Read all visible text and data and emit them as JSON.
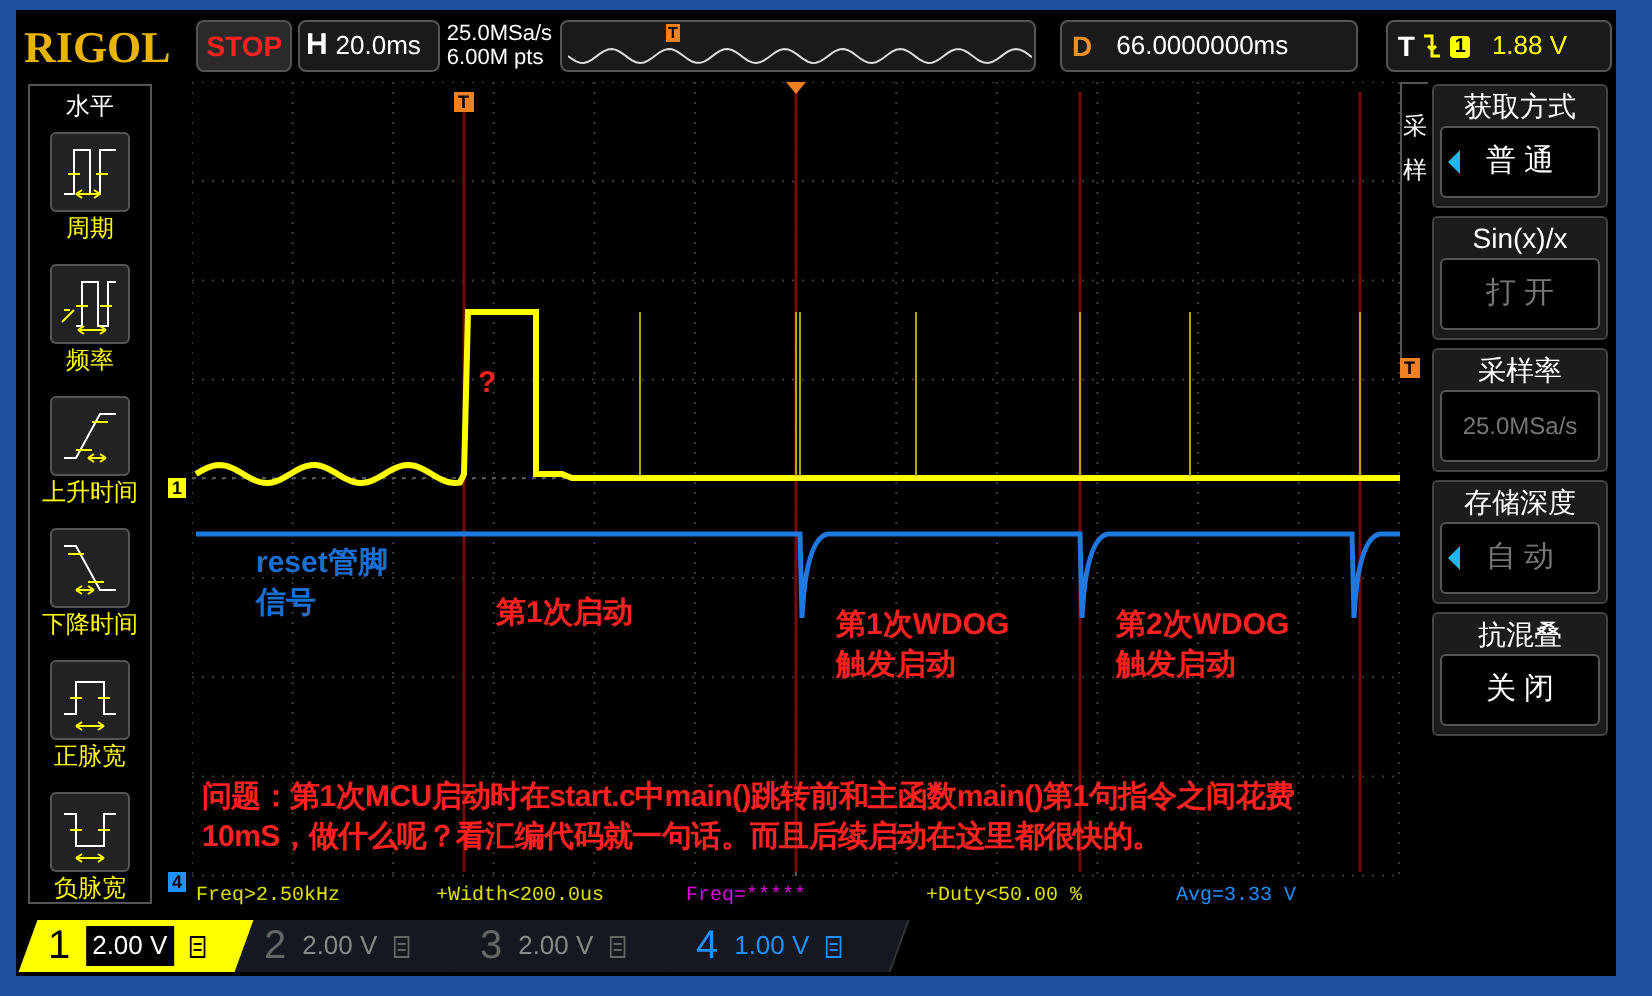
{
  "top_bar": {
    "logo": "RIGOL",
    "run_state": "STOP",
    "horizontal": {
      "label": "H",
      "value": "20.0ms"
    },
    "sample_rate": "25.0MSa/s",
    "memory_depth": "6.00M pts",
    "overview_trigger": "T",
    "delay": {
      "label": "D",
      "value": "66.0000000ms"
    },
    "trigger": {
      "label": "T",
      "source": "1",
      "level": "1.88 V"
    }
  },
  "left_menu": {
    "title": "水平",
    "items": [
      {
        "label": "周期",
        "kind": "period"
      },
      {
        "label": "频率",
        "kind": "frequency"
      },
      {
        "label": "上升时间",
        "kind": "rise"
      },
      {
        "label": "下降时间",
        "kind": "fall"
      },
      {
        "label": "正脉宽",
        "kind": "positive_width"
      },
      {
        "label": "负脉宽",
        "kind": "negative_width"
      }
    ]
  },
  "display": {
    "channel_markers": [
      {
        "label": "1",
        "color": "#ffff00"
      },
      {
        "label": "4",
        "color": "#1e90ff"
      }
    ],
    "trigger_marker": "T",
    "right_trigger_marker": "T",
    "annotations": [
      {
        "text": "?",
        "color": "#ff2020"
      },
      {
        "text": "reset管脚",
        "color": "#1a6fd0"
      },
      {
        "text": "信号",
        "color": "#1a6fd0"
      },
      {
        "text": "第1次启动",
        "color": "#ff2020"
      },
      {
        "text": "第1次WDOG",
        "color": "#ff2020"
      },
      {
        "text": "触发启动",
        "color": "#ff2020"
      },
      {
        "text": "第2次WDOG",
        "color": "#ff2020"
      },
      {
        "text": "触发启动",
        "color": "#ff2020"
      },
      {
        "text": "问题：第1次MCU启动时在start.c中main()跳转前和主函数main()第1句指令之间花费10mS，做什么呢？看汇编代码就一句话。而且后续启动在这里都很快的。",
        "color": "#ff2020"
      }
    ]
  },
  "right_menu": {
    "tab": [
      "采",
      "样"
    ],
    "items": [
      {
        "title": "获取方式",
        "value": "普 通",
        "enabled": true,
        "arrow": true
      },
      {
        "title": "Sin(x)/x",
        "value": "打 开",
        "enabled": false,
        "arrow": false
      },
      {
        "title": "采样率",
        "value": "25.0MSa/s",
        "enabled": false,
        "arrow": false
      },
      {
        "title": "存储深度",
        "value": "自 动",
        "enabled": false,
        "arrow": true
      },
      {
        "title": "抗混叠",
        "value": "关 闭",
        "enabled": true,
        "arrow": false
      }
    ]
  },
  "measurements": [
    {
      "text": "Freq>2.50kHz",
      "color": "#e0e000"
    },
    {
      "text": "+Width<200.0us",
      "color": "#e0e000"
    },
    {
      "text": "Freq=*****",
      "color": "#e000e0"
    },
    {
      "text": "+Duty<50.00 %",
      "color": "#e0e000"
    },
    {
      "text": "Avg=3.33 V",
      "color": "#1e90ff"
    }
  ],
  "channels": [
    {
      "number": "1",
      "scale": "2.00 V",
      "on": true,
      "selected": true
    },
    {
      "number": "2",
      "scale": "2.00 V",
      "on": false,
      "selected": false
    },
    {
      "number": "3",
      "scale": "2.00 V",
      "on": false,
      "selected": false
    },
    {
      "number": "4",
      "scale": "1.00 V",
      "on": true,
      "selected": false
    }
  ]
}
